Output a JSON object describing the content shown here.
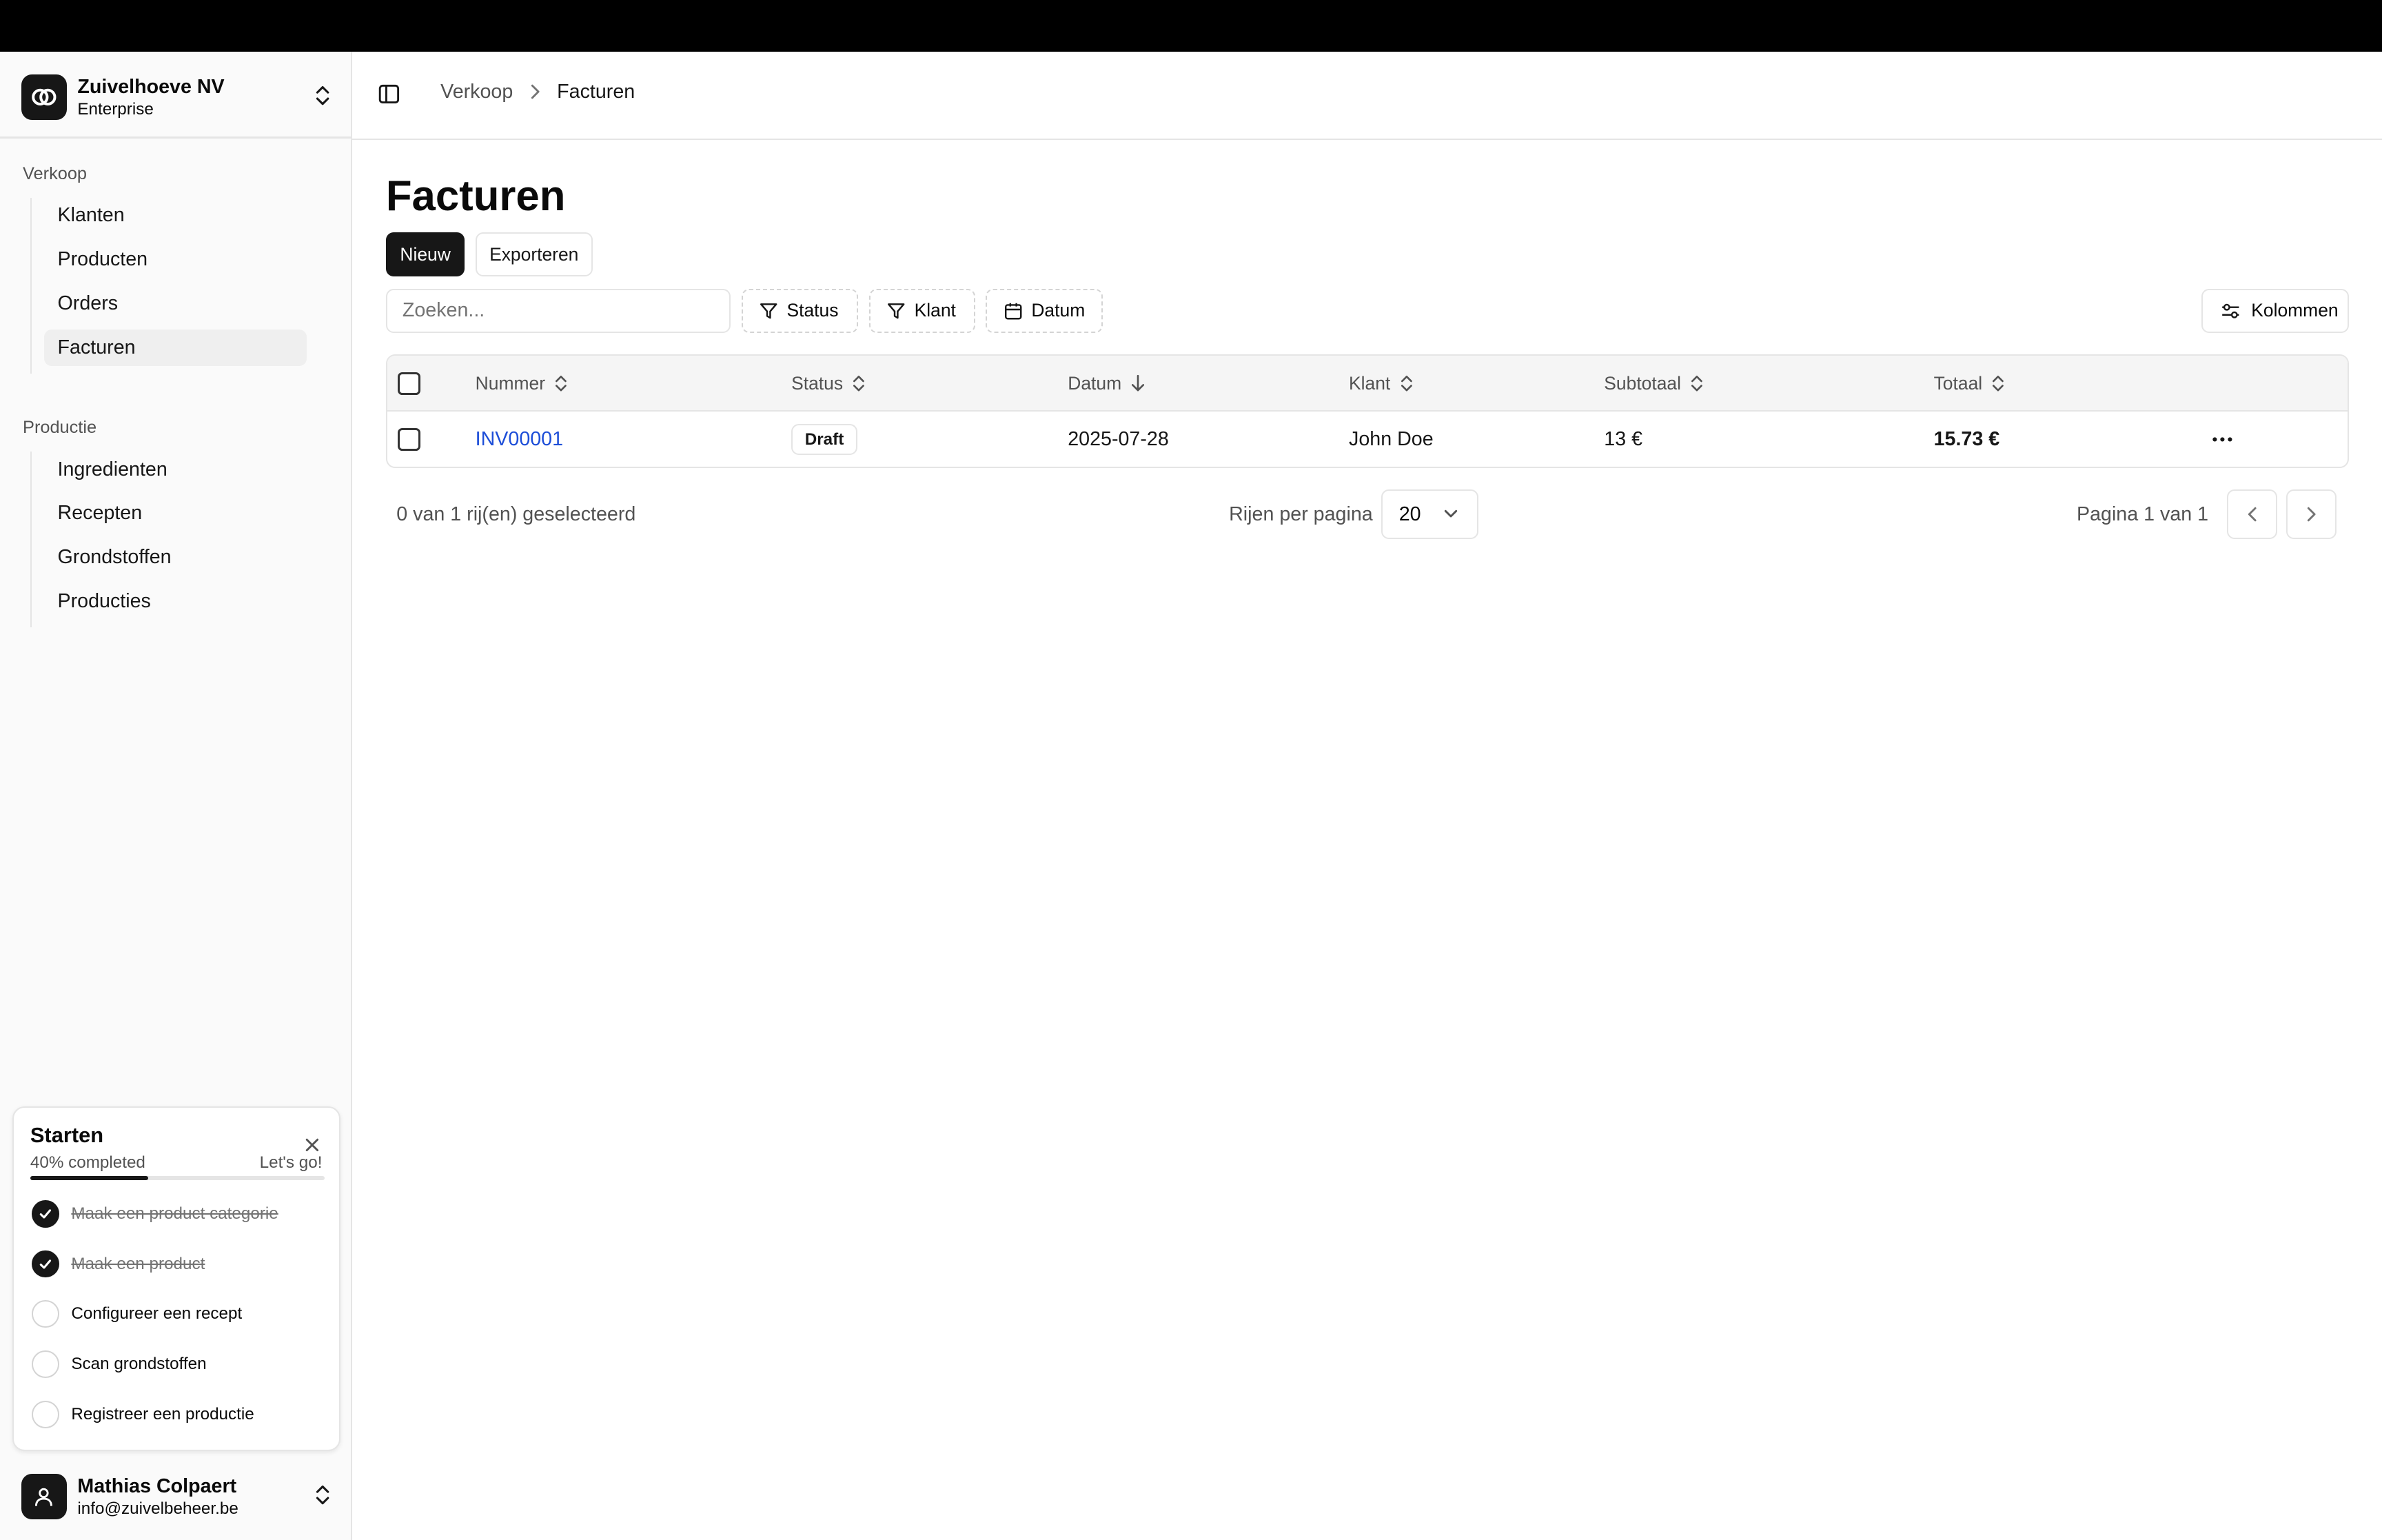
{
  "team": {
    "name": "Zuivelhoeve NV",
    "plan": "Enterprise"
  },
  "sidebar": {
    "groups": [
      {
        "label": "Verkoop",
        "items": [
          {
            "label": "Klanten"
          },
          {
            "label": "Producten"
          },
          {
            "label": "Orders"
          },
          {
            "label": "Facturen",
            "active": true
          }
        ]
      },
      {
        "label": "Productie",
        "items": [
          {
            "label": "Ingredienten"
          },
          {
            "label": "Recepten"
          },
          {
            "label": "Grondstoffen"
          },
          {
            "label": "Producties"
          }
        ]
      }
    ]
  },
  "onboarding": {
    "title": "Starten",
    "progress_label": "40% completed",
    "progress": 0.4,
    "cta": "Let's go!",
    "steps": [
      {
        "label": "Maak een product categorie",
        "done": true
      },
      {
        "label": "Maak een product",
        "done": true
      },
      {
        "label": "Configureer een recept",
        "done": false
      },
      {
        "label": "Scan grondstoffen",
        "done": false
      },
      {
        "label": "Registreer een productie",
        "done": false
      }
    ]
  },
  "user": {
    "name": "Mathias Colpaert",
    "email": "info@zuivelbeheer.be"
  },
  "breadcrumb": [
    "Verkoop",
    "Facturen"
  ],
  "page": {
    "title": "Facturen"
  },
  "toolbar": {
    "new_label": "Nieuw",
    "export_label": "Exporteren",
    "search_placeholder": "Zoeken...",
    "filters": [
      "Status",
      "Klant",
      "Datum"
    ],
    "columns_label": "Kolommen"
  },
  "table": {
    "columns": [
      "Nummer",
      "Status",
      "Datum",
      "Klant",
      "Subtotaal",
      "Totaal"
    ],
    "sort": {
      "column": "Datum",
      "direction": "desc"
    },
    "rows": [
      {
        "nummer": "INV00001",
        "status": "Draft",
        "datum": "2025-07-28",
        "klant": "John Doe",
        "subtotaal": "13 €",
        "totaal": "15.73 €"
      }
    ]
  },
  "pagination": {
    "selected_text": "0 van 1 rij(en) geselecteerd",
    "rows_per_page_label": "Rijen per pagina",
    "rows_per_page": "20",
    "page_text": "Pagina 1 van 1"
  },
  "colors": {
    "primary": "#171717",
    "link": "#1d4ed8",
    "sidebar_bg": "#fafafa",
    "border": "#e5e5e5"
  }
}
